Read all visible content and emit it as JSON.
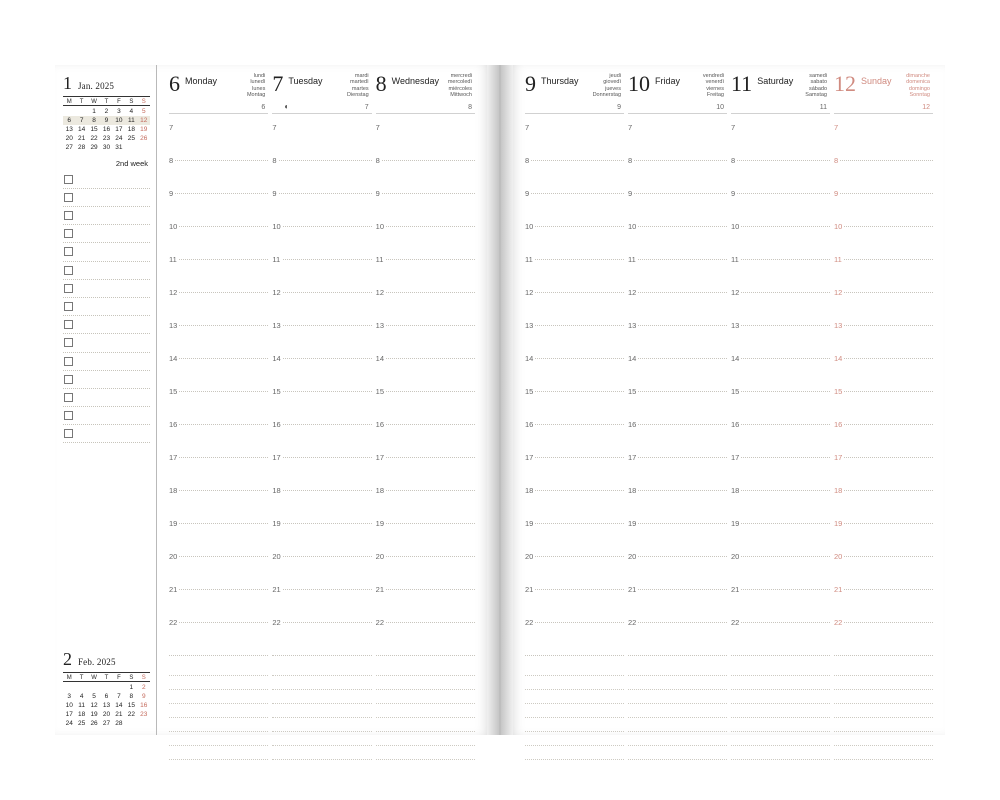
{
  "week_label": "2nd week",
  "dow": [
    "M",
    "T",
    "W",
    "T",
    "F",
    "S",
    "S"
  ],
  "hours": [
    7,
    8,
    9,
    10,
    11,
    12,
    13,
    14,
    15,
    16,
    17,
    18,
    19,
    20,
    21,
    22
  ],
  "mini": [
    {
      "num": "1",
      "label": "Jan. 2025",
      "rows": [
        [
          "",
          "",
          "1",
          "2",
          "3",
          "4",
          "5"
        ],
        [
          "6",
          "7",
          "8",
          "9",
          "10",
          "11",
          "12"
        ],
        [
          "13",
          "14",
          "15",
          "16",
          "17",
          "18",
          "19"
        ],
        [
          "20",
          "21",
          "22",
          "23",
          "24",
          "25",
          "26"
        ],
        [
          "27",
          "28",
          "29",
          "30",
          "31",
          "",
          ""
        ]
      ],
      "highlight_row": 1
    },
    {
      "num": "2",
      "label": "Feb. 2025",
      "rows": [
        [
          "",
          "",
          "",
          "",
          "",
          "1",
          "2"
        ],
        [
          "3",
          "4",
          "5",
          "6",
          "7",
          "8",
          "9"
        ],
        [
          "10",
          "11",
          "12",
          "13",
          "14",
          "15",
          "16"
        ],
        [
          "17",
          "18",
          "19",
          "20",
          "21",
          "22",
          "23"
        ],
        [
          "24",
          "25",
          "26",
          "27",
          "28",
          "",
          ""
        ]
      ]
    }
  ],
  "days": [
    {
      "n": "6",
      "name": "Monday",
      "dayno": "6",
      "langs": [
        "lundi",
        "lunedì",
        "lunes",
        "Montag"
      ]
    },
    {
      "n": "7",
      "name": "Tuesday",
      "dayno": "7",
      "langs": [
        "mardi",
        "martedì",
        "martes",
        "Dienstag"
      ],
      "moon": "◐"
    },
    {
      "n": "8",
      "name": "Wednesday",
      "dayno": "8",
      "langs": [
        "mercredi",
        "mercoledì",
        "miércoles",
        "Mittwoch"
      ]
    },
    {
      "n": "9",
      "name": "Thursday",
      "dayno": "9",
      "langs": [
        "jeudi",
        "giovedì",
        "jueves",
        "Donnerstag"
      ]
    },
    {
      "n": "10",
      "name": "Friday",
      "dayno": "10",
      "langs": [
        "vendredi",
        "venerdì",
        "viernes",
        "Freitag"
      ]
    },
    {
      "n": "11",
      "name": "Saturday",
      "dayno": "11",
      "langs": [
        "samedi",
        "sabato",
        "sábado",
        "Samstag"
      ]
    },
    {
      "n": "12",
      "name": "Sunday",
      "dayno": "12",
      "langs": [
        "dimanche",
        "domenica",
        "domingo",
        "Sonntag"
      ],
      "sun": true
    }
  ],
  "todo_count": 15,
  "note_lines": 7
}
